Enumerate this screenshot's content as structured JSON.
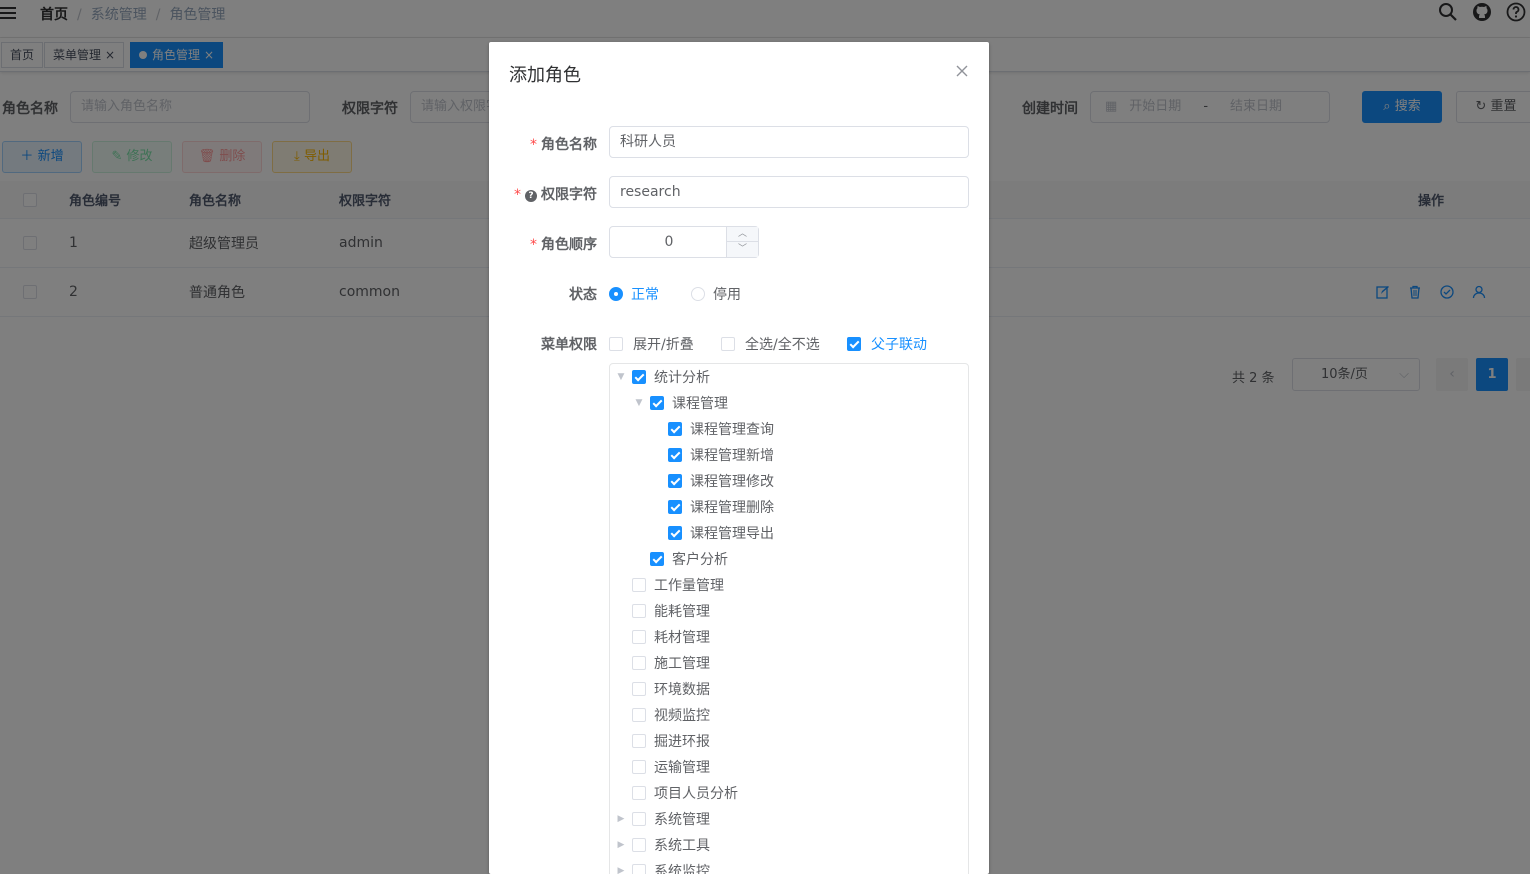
{
  "navbar": {
    "breadcrumb": [
      "首页",
      "系统管理",
      "角色管理"
    ]
  },
  "tags": [
    {
      "label": "首页",
      "active": false
    },
    {
      "label": "菜单管理",
      "active": false
    },
    {
      "label": "角色管理",
      "active": true
    }
  ],
  "search": {
    "role_name_label": "角色名称",
    "role_name_placeholder": "请输入角色名称",
    "perm_label": "权限字符",
    "perm_placeholder": "请输入权限字符",
    "created_label": "创建时间",
    "start_placeholder": "开始日期",
    "range_sep": "-",
    "end_placeholder": "结束日期",
    "search_btn": "搜索",
    "reset_btn": "重置"
  },
  "toolbar": {
    "add": "新增",
    "edit": "修改",
    "delete": "删除",
    "export": "导出"
  },
  "table": {
    "columns": [
      "角色编号",
      "角色名称",
      "权限字符",
      "操作"
    ],
    "rows": [
      {
        "id": "1",
        "name": "超级管理员",
        "key": "admin"
      },
      {
        "id": "2",
        "name": "普通角色",
        "key": "common"
      }
    ]
  },
  "pagination": {
    "total": "共 2 条",
    "page_size": "10条/页",
    "current": "1"
  },
  "dialog": {
    "title": "添加角色",
    "role_name_label": "角色名称",
    "role_name_value": "科研人员",
    "perm_label": "权限字符",
    "perm_value": "research",
    "order_label": "角色顺序",
    "order_value": "0",
    "status_label": "状态",
    "status_normal": "正常",
    "status_disabled": "停用",
    "menu_label": "菜单权限",
    "opt_expand": "展开/折叠",
    "opt_selectall": "全选/全不选",
    "opt_link": "父子联动",
    "tree": [
      {
        "label": "统计分析",
        "level": 0,
        "checked": true,
        "caret": "down"
      },
      {
        "label": "课程管理",
        "level": 1,
        "checked": true,
        "caret": "down"
      },
      {
        "label": "课程管理查询",
        "level": 2,
        "checked": true,
        "caret": "none"
      },
      {
        "label": "课程管理新增",
        "level": 2,
        "checked": true,
        "caret": "none"
      },
      {
        "label": "课程管理修改",
        "level": 2,
        "checked": true,
        "caret": "none"
      },
      {
        "label": "课程管理删除",
        "level": 2,
        "checked": true,
        "caret": "none"
      },
      {
        "label": "课程管理导出",
        "level": 2,
        "checked": true,
        "caret": "none"
      },
      {
        "label": "客户分析",
        "level": 1,
        "checked": true,
        "caret": "none"
      },
      {
        "label": "工作量管理",
        "level": 0,
        "checked": false,
        "caret": "none"
      },
      {
        "label": "能耗管理",
        "level": 0,
        "checked": false,
        "caret": "none"
      },
      {
        "label": "耗材管理",
        "level": 0,
        "checked": false,
        "caret": "none"
      },
      {
        "label": "施工管理",
        "level": 0,
        "checked": false,
        "caret": "none"
      },
      {
        "label": "环境数据",
        "level": 0,
        "checked": false,
        "caret": "none"
      },
      {
        "label": "视频监控",
        "level": 0,
        "checked": false,
        "caret": "none"
      },
      {
        "label": "掘进环报",
        "level": 0,
        "checked": false,
        "caret": "none"
      },
      {
        "label": "运输管理",
        "level": 0,
        "checked": false,
        "caret": "none"
      },
      {
        "label": "项目人员分析",
        "level": 0,
        "checked": false,
        "caret": "none"
      },
      {
        "label": "系统管理",
        "level": 0,
        "checked": false,
        "caret": "right"
      },
      {
        "label": "系统工具",
        "level": 0,
        "checked": false,
        "caret": "right"
      },
      {
        "label": "系统监控",
        "level": 0,
        "checked": false,
        "caret": "right"
      }
    ]
  },
  "colors": {
    "primary": "#1890ff",
    "danger": "#ff4949",
    "success": "#13ce66",
    "warning": "#ffba00"
  }
}
